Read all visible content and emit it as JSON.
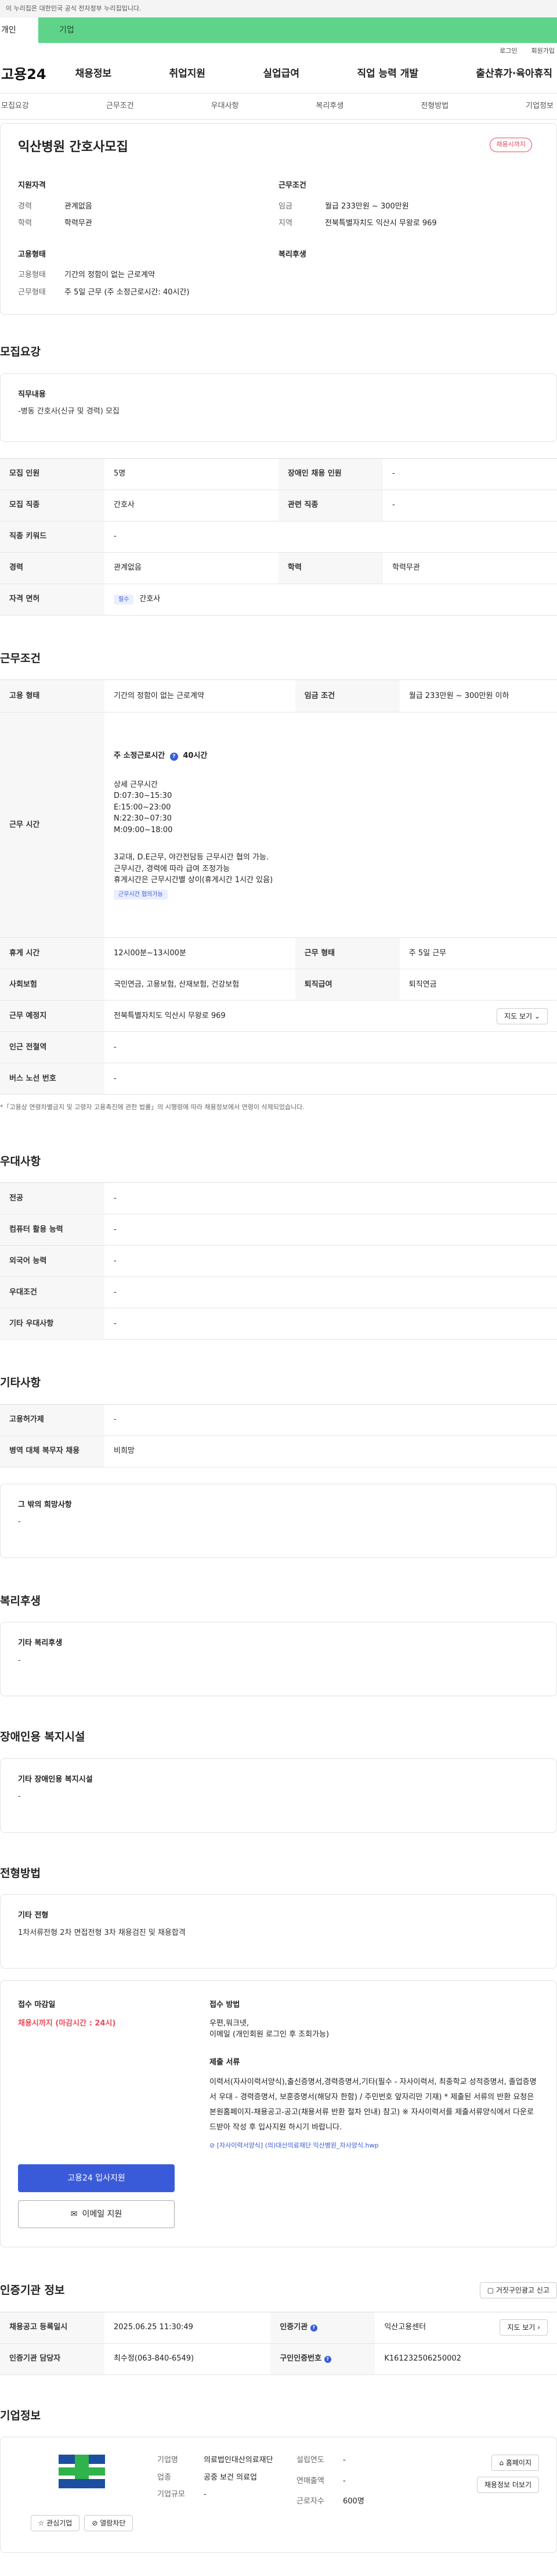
{
  "gov_banner": "이 누리집은 대한민국 공식 전자정부 누리집입니다.",
  "user_tabs": [
    "개인",
    "기업"
  ],
  "top_links": [
    "로그인",
    "회원가입"
  ],
  "logo": "고용24",
  "gnb": [
    "채용정보",
    "취업지원",
    "실업급여",
    "직업 능력 개발",
    "출산휴가·육아휴직"
  ],
  "anchors": [
    "모집요강",
    "근무조건",
    "우대사항",
    "복리후생",
    "전형방법",
    "기업정보"
  ],
  "job": {
    "title": "익산병원 간호사모집",
    "status": "채용시까지",
    "qual_title": "지원자격",
    "qual": [
      {
        "k": "경력",
        "v": "관계없음"
      },
      {
        "k": "학력",
        "v": "학력무관"
      }
    ],
    "cond_title": "근무조건",
    "cond": [
      {
        "k": "임금",
        "v": "월급 233만원 ~ 300만원"
      },
      {
        "k": "지역",
        "v": "전북특별자치도 익산시 무왕로 969"
      }
    ],
    "emp_title": "고용형태",
    "emp": [
      {
        "k": "고용형태",
        "v": "기간의 정함이 없는 근로계약"
      },
      {
        "k": "근무형태",
        "v": "주 5일 근무 (주 소정근로시간: 40시간)"
      }
    ],
    "welfare_title": "복리후생"
  },
  "recruit": {
    "title": "모집요강",
    "duty_title": "직무내용",
    "duty_text": "-병동 간호사(신규 및 경력) 모집",
    "rows": [
      {
        "th": "모집 인원",
        "td": "5명",
        "th2": "장애인 채용 인원",
        "td2": "-"
      },
      {
        "th": "모집 직종",
        "td": "간호사",
        "th2": "관련 직종",
        "td2": "-"
      },
      {
        "th": "직종 키워드",
        "td": "-"
      },
      {
        "th": "경력",
        "td": "관계없음",
        "th2": "학력",
        "td2": "학력무관"
      }
    ],
    "license_th": "자격 면허",
    "license_badge": "필수",
    "license": "간호사"
  },
  "work": {
    "title": "근무조건",
    "emp_th": "고용 형태",
    "emp_td": "기간의 정함이 없는 근로계약",
    "wage_th": "임금 조건",
    "wage_td": "월급 233만원 ~ 300만원 이하",
    "time_th": "근무 시간",
    "time_head": "주 소정근로시간",
    "time_hours": "40시간",
    "time_detail_title": "상세 근무시간",
    "time_lines": [
      "D:07:30~15:30",
      "E:15:00~23:00",
      "N:22:30~07:30",
      "M:09:00~18:00"
    ],
    "time_notes": [
      "3교대, D.E근무, 야간전담등 근무시간 협의 가능.",
      "근무시간, 경력에 따라 급여 조정가능",
      "휴게시간은 근무시간별 상이(휴게시간 1시간 있음)"
    ],
    "time_link": "근무시간 협의가능",
    "rest_th": "휴게 시간",
    "rest_td": "12시00분~13시00분",
    "shape_th": "근무 형태",
    "shape_td": "주 5일 근무",
    "ins_th": "사회보험",
    "ins_td": "국민연금, 고용보험, 산재보험, 건강보험",
    "ret_th": "퇴직급여",
    "ret_td": "퇴직연금",
    "place_th": "근무 예정지",
    "place_td": "전북특별자치도 익산시 무왕로 969",
    "map_btn": "지도 보기",
    "sub_th": "인근 전철역",
    "sub_td": "-",
    "bus_th": "버스 노선 번호",
    "bus_td": "-",
    "note": "*「고용상 연령차별금지 및 고령자 고용촉진에 관한 법률」의 시행령에 따라 채용정보에서 연령이 삭제되었습니다."
  },
  "pref": {
    "title": "우대사항",
    "rows": [
      {
        "th": "전공",
        "td": "-"
      },
      {
        "th": "컴퓨터 활용 능력",
        "td": "-"
      },
      {
        "th": "외국어 능력",
        "td": "-"
      },
      {
        "th": "우대조건",
        "td": "-"
      },
      {
        "th": "기타 우대사항",
        "td": "-"
      }
    ]
  },
  "etc": {
    "title": "기타사항",
    "rows": [
      {
        "th": "고용허가제",
        "td": "-"
      },
      {
        "th": "병역 대체 복무자 채용",
        "td": "비희망"
      }
    ],
    "hope_title": "그 밖의 희망사항",
    "hope_text": "-"
  },
  "welfare": {
    "title": "복리후생",
    "box_title": "기타 복리후생",
    "box_text": "-"
  },
  "disab": {
    "title": "장애인용 복지시설",
    "box_title": "기타 장애인용 복지시설",
    "box_text": "-"
  },
  "process": {
    "title": "전형방법",
    "box_title": "기타 전형",
    "box_text": "1차서류전형 2차 면접전형 3차 채용검진 및 채용합격",
    "deadline_title": "접수 마감일",
    "deadline": "채용시까지 (마감시간 : 24시)",
    "apply_btn": "고용24 입사지원",
    "email_btn": "이메일 지원",
    "method_title": "접수 방법",
    "method_lines": [
      "우편,워크넷,",
      "이메일 (개인회원 로그인 후 조회가능)"
    ],
    "docs_title": "제출 서류",
    "docs_text": "이력서(자사이력서양식),출신증명서,경력증명서,기타(필수 - 자사이력서, 최종학교 성적증명서, 졸업증명서 우대 - 경력증명서, 보훈증명서(해당자 한함) / 주민번호 앞자리만 기재) * 제출된 서류의 반환 요청은 본원홈페이지-채용공고-공고(채용서류 반환 절차 안내) 참고) ※ 자사이력서를 제출서류양식에서 다운로드받아 작성 후 입사지원 하시기 바랍니다.",
    "file": "[자사이력서양식] (의)대산의료재단 익산병원_자사양식.hwp"
  },
  "agency": {
    "title": "인증기관 정보",
    "report_btn": "거짓구인광고 신고",
    "rows": [
      {
        "th": "채용공고 등록일시",
        "td": "2025.06.25 11:30:49",
        "th2": "인증기관",
        "td2": "익산고용센터"
      },
      {
        "th": "인증기관 담당자",
        "td": "최수정(063-840-6549)",
        "th2": "구인인증번호",
        "td2": "K161232506250002"
      }
    ],
    "map_btn": "지도 보기"
  },
  "company": {
    "title": "기업정보",
    "fav_btn": "관심기업",
    "block_btn": "열람차단",
    "labels": {
      "type": "기업명",
      "ind": "업종",
      "size": "기업규모",
      "year": "설립연도",
      "sales": "연매출액",
      "emp": "근로자수"
    },
    "values": {
      "type": "의료법인대산의료재단",
      "ind": "공중 보건 의료업",
      "size": "-",
      "year": "-",
      "sales": "-",
      "emp": "600명"
    },
    "home_btn": "홈페이지",
    "more_btn": "채용정보 더보기"
  },
  "colors": {
    "accent": "#3a5bd9",
    "green": "#5fd38a",
    "red": "#e74c5a"
  }
}
